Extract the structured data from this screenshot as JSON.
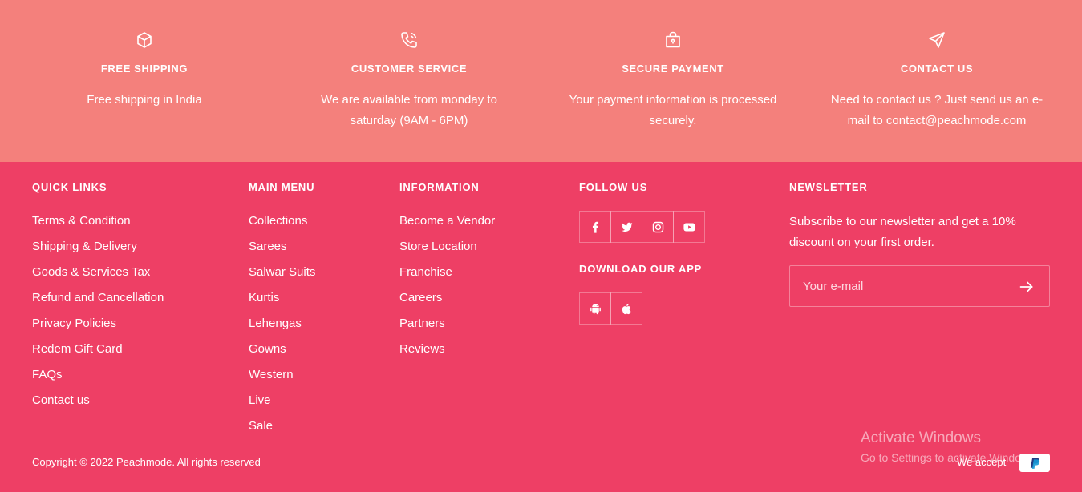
{
  "features": [
    {
      "icon": "box-icon",
      "title": "FREE SHIPPING",
      "text": "Free shipping in India"
    },
    {
      "icon": "phone-icon",
      "title": "CUSTOMER SERVICE",
      "text": "We are available from monday to saturday (9AM - 6PM)"
    },
    {
      "icon": "shopping-bag-icon",
      "title": "SECURE PAYMENT",
      "text": "Your payment information is processed securely."
    },
    {
      "icon": "paper-plane-icon",
      "title": "CONTACT US",
      "text": "Need to contact us ? Just send us an e-mail to contact@peachmode.com"
    }
  ],
  "footer": {
    "quick_links": {
      "title": "QUICK LINKS",
      "items": [
        "Terms & Condition",
        "Shipping & Delivery",
        "Goods & Services Tax",
        "Refund and Cancellation",
        "Privacy Policies",
        "Redem Gift Card",
        "FAQs",
        "Contact us"
      ]
    },
    "main_menu": {
      "title": "MAIN MENU",
      "items": [
        "Collections",
        "Sarees",
        "Salwar Suits",
        "Kurtis",
        "Lehengas",
        "Gowns",
        "Western",
        "Live",
        "Sale"
      ]
    },
    "information": {
      "title": "INFORMATION",
      "items": [
        "Become a Vendor",
        "Store Location",
        "Franchise",
        "Careers",
        "Partners",
        "Reviews"
      ]
    },
    "follow": {
      "title": "FOLLOW US",
      "social": [
        "facebook-icon",
        "twitter-icon",
        "instagram-icon",
        "youtube-icon"
      ],
      "app_title": "DOWNLOAD OUR APP",
      "apps": [
        "android-icon",
        "apple-icon"
      ]
    },
    "newsletter": {
      "title": "NEWSLETTER",
      "text": "Subscribe to our newsletter and get a 10% discount on your first order.",
      "placeholder": "Your e-mail"
    },
    "copyright": "Copyright © 2022 Peachmode. All rights reserved",
    "we_accept": "We accept"
  },
  "watermark": {
    "line1": "Activate Windows",
    "line2": "Go to Settings to activate Windows."
  },
  "colors": {
    "features_bg": "#f4807c",
    "footer_bg": "#ee3f65",
    "paypal_dark": "#253b80",
    "paypal_light": "#179bd7"
  }
}
